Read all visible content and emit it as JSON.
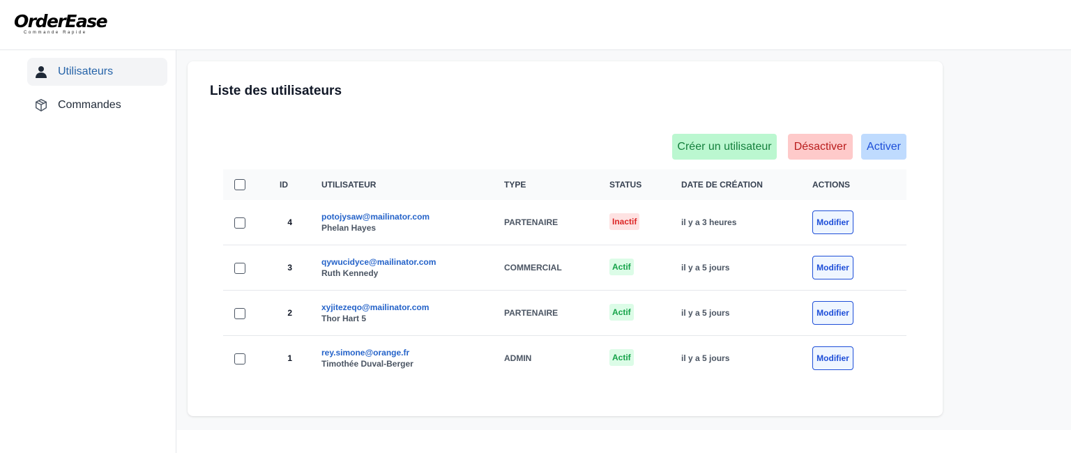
{
  "brand": {
    "name": "OrderEase",
    "tagline": "Commande Rapide"
  },
  "sidebar": {
    "items": [
      {
        "label": "Utilisateurs",
        "icon": "user-icon",
        "active": true
      },
      {
        "label": "Commandes",
        "icon": "package-icon",
        "active": false
      }
    ]
  },
  "page": {
    "title": "Liste des utilisateurs"
  },
  "toolbar": {
    "create_label": "Créer un utilisateur",
    "deactivate_label": "Désactiver",
    "activate_label": "Activer"
  },
  "table": {
    "headers": [
      "ID",
      "UTILISATEUR",
      "TYPE",
      "STATUS",
      "DATE DE CRÉATION",
      "ACTIONS"
    ],
    "rows": [
      {
        "id": "4",
        "email": "potojysaw@mailinator.com",
        "name": "Phelan Hayes",
        "type": "PARTENAIRE",
        "status": "Inactif",
        "created": "il y a 3 heures",
        "action": "Modifier"
      },
      {
        "id": "3",
        "email": "qywucidyce@mailinator.com",
        "name": "Ruth Kennedy",
        "type": "COMMERCIAL",
        "status": "Actif",
        "created": "il y a 5 jours",
        "action": "Modifier"
      },
      {
        "id": "2",
        "email": "xyjitezeqo@mailinator.com",
        "name": "Thor Hart 5",
        "type": "PARTENAIRE",
        "status": "Actif",
        "created": "il y a 5 jours",
        "action": "Modifier"
      },
      {
        "id": "1",
        "email": "rey.simone@orange.fr",
        "name": "Timothée Duval-Berger",
        "type": "ADMIN",
        "status": "Actif",
        "created": "il y a 5 jours",
        "action": "Modifier"
      }
    ]
  },
  "colors": {
    "accent": "#2563c9",
    "active_badge": "#16a34a",
    "inactive_badge": "#dc2626"
  }
}
